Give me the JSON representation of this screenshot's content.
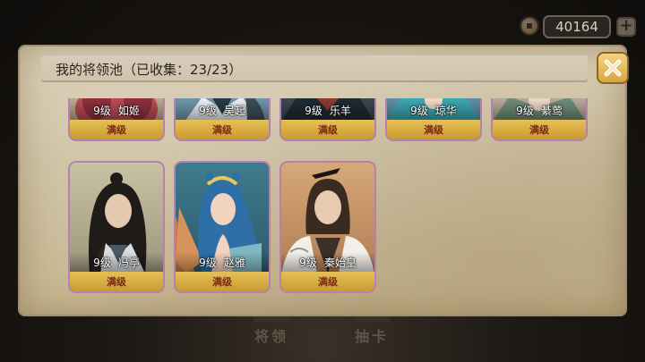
{
  "currency": {
    "amount": "40164",
    "icon": "coin-icon"
  },
  "panel": {
    "title": "我的将领池（已收集：23/23）"
  },
  "bottom_nav": {
    "generals_label": "将领",
    "draw_label": "抽卡"
  },
  "cards": [
    {
      "level": "9级",
      "name": "如姬",
      "status": "满级"
    },
    {
      "level": "9级",
      "name": "吴起",
      "status": "满级"
    },
    {
      "level": "9级",
      "name": "乐羊",
      "status": "满级"
    },
    {
      "level": "9级",
      "name": "琼华",
      "status": "满级"
    },
    {
      "level": "9级",
      "name": "綦莺",
      "status": "满级"
    },
    {
      "level": "9级",
      "name": "冯亭",
      "status": "满级"
    },
    {
      "level": "9级",
      "name": "赵雅",
      "status": "满级"
    },
    {
      "level": "9级",
      "name": "秦始皇",
      "status": "满级"
    }
  ]
}
